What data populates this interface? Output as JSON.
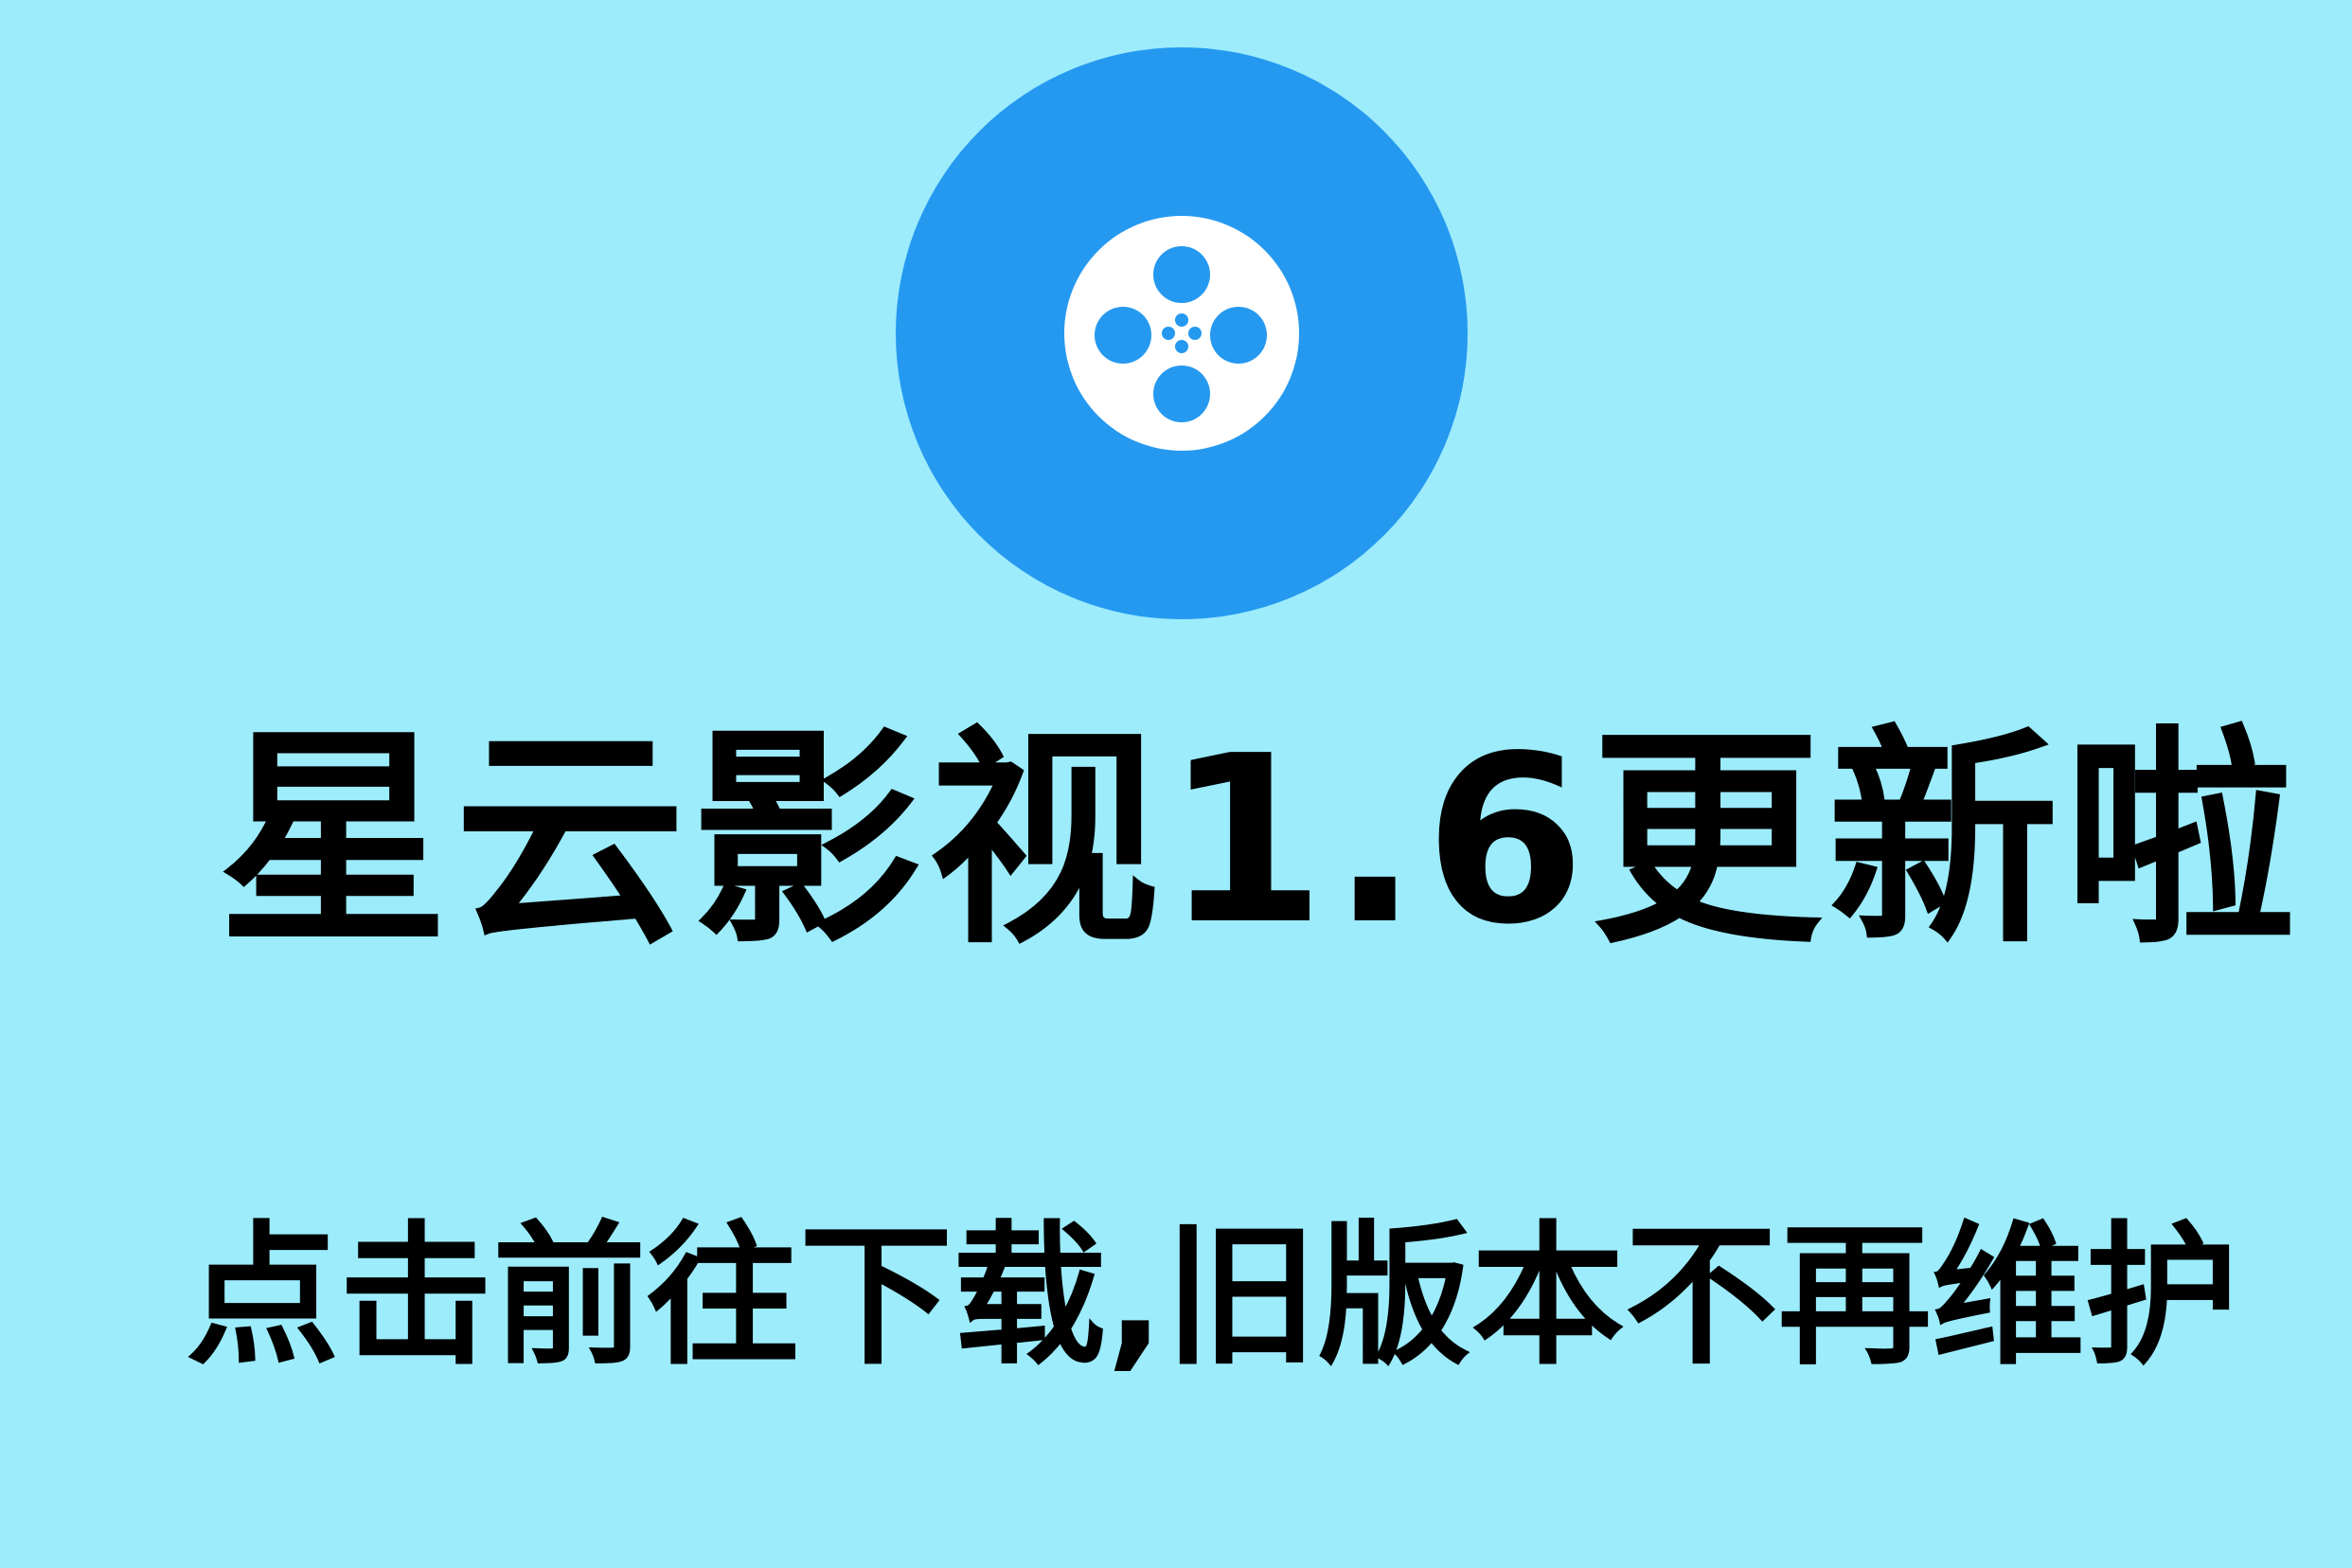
{
  "app": {
    "icon": "film-reel-icon",
    "icon_bg_color": "#2599f0",
    "reel_color": "#ffffff"
  },
  "headline": "星云影视1.6更新啦",
  "cta_link": "点击前往下载,旧版本不再维护",
  "colors": {
    "background": "#9cecfc",
    "text": "#000000"
  }
}
